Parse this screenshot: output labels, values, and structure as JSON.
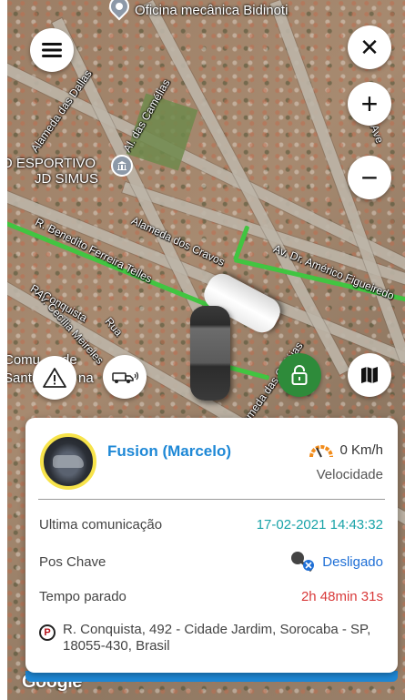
{
  "map": {
    "poi_top": "Oficina mecânica Bidinoti",
    "poi_sport_line1": "O ESPORTIVO",
    "poi_sport_line2": "JD SIMUS",
    "poi_left_line1": "Comu",
    "poi_left_line2": "de",
    "poi_left_line3": "Santa",
    "poi_left_line4": "na",
    "street_dallas": "Alameda das Dallas",
    "street_camelias": "Al. das Camélias",
    "street_cravos": "Alameda dos Cravos",
    "street_benedito": "R. Benedito Ferreira Telles",
    "street_americo": "Av. Dr. Américo Figueiredo",
    "street_conquista": "R. Conquista",
    "street_cecilia": "Av. Cecília Meireles",
    "street_catleias": "Alameda das Catléias",
    "street_rua": "Rua",
    "street_ave": "Ave",
    "google": "Google"
  },
  "controls": {
    "menu_icon": "menu-icon",
    "close_symbol": "✕",
    "zoom_in_symbol": "+",
    "zoom_out_symbol": "−"
  },
  "card": {
    "vehicle_name": "Fusion (Marcelo)",
    "speed": "0 Km/h",
    "speed_caption": "Velocidade",
    "last_comm_label": "Ultima comunicação",
    "last_comm_value": "17-02-2021 14:43:32",
    "key_label": "Pos Chave",
    "key_value": "Desligado",
    "stopped_label": "Tempo parado",
    "stopped_value": "2h 48min 31s",
    "address": "R. Conquista, 492 - Cidade Jardim, Sorocaba - SP, 18055-430, Brasil",
    "address_icon_letter": "P"
  },
  "colors": {
    "accent_blue": "#1e88d6",
    "route_green": "#41c541",
    "lock_green": "#2e8b3a",
    "teal": "#19a3a8",
    "red": "#d93a3a",
    "avatar_ring": "#f7e34a"
  }
}
